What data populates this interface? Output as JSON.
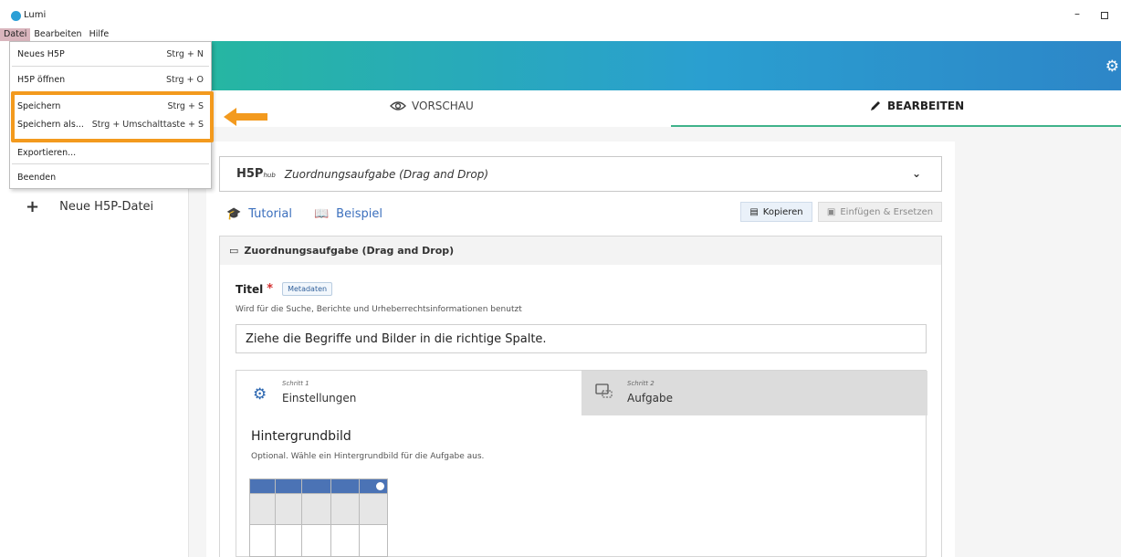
{
  "window": {
    "title": "Lumi",
    "minimize_glyph": "–"
  },
  "menubar": {
    "items": [
      "Datei",
      "Bearbeiten",
      "Hilfe"
    ]
  },
  "file_menu": {
    "items": [
      {
        "label": "Neues H5P",
        "shortcut": "Strg + N"
      },
      {
        "label": "H5P öffnen",
        "shortcut": "Strg + O"
      },
      {
        "label": "Speichern",
        "shortcut": "Strg + S"
      },
      {
        "label": "Speichern als...",
        "shortcut": "Strg + Umschalttaste + S"
      },
      {
        "label": "Exportieren..."
      },
      {
        "label": "Beenden"
      }
    ],
    "highlight_color": "#f39a1e"
  },
  "sidebar": {
    "new_file_label": "Neue H5P-Datei"
  },
  "tabs": {
    "preview": "VORSCHAU",
    "edit": "BEARBEITEN"
  },
  "hub": {
    "logo_main": "H5P",
    "logo_sub": "hub",
    "selected_type": "Zuordnungsaufgabe (Drag and Drop)"
  },
  "links": {
    "tutorial": "Tutorial",
    "example": "Beispiel"
  },
  "actions": {
    "copy": "Kopieren",
    "paste": "Einfügen & Ersetzen"
  },
  "section": {
    "title": "Zuordnungsaufgabe (Drag and Drop)"
  },
  "title_field": {
    "label": "Titel",
    "required_mark": "*",
    "metadata_button": "Metadaten",
    "description": "Wird für die Suche, Berichte und Urheberrechtsinformationen benutzt",
    "value": "Ziehe die Begriffe und Bilder in die richtige Spalte."
  },
  "steps": [
    {
      "small": "Schritt 1",
      "label": "Einstellungen",
      "icon": "gear-icon"
    },
    {
      "small": "Schritt 2",
      "label": "Aufgabe",
      "icon": "drag-drop-icon"
    }
  ],
  "background": {
    "title": "Hintergrundbild",
    "description": "Optional. Wähle ein Hintergrundbild für die Aufgabe aus."
  },
  "colors": {
    "header_start": "#26b7a0",
    "header_end": "#2d86c8",
    "accent_underline": "#3fb28a",
    "link": "#3b6fbd"
  }
}
